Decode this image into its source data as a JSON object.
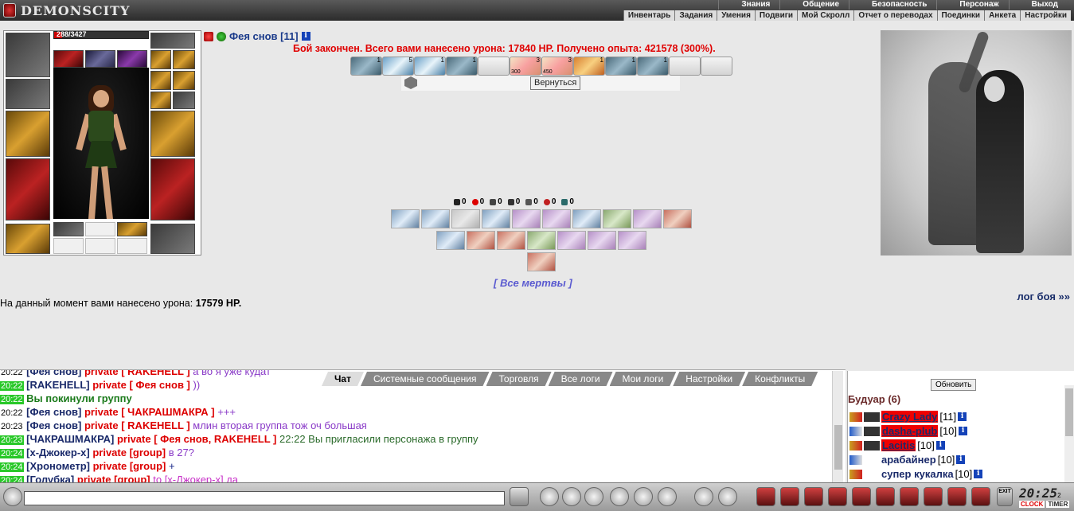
{
  "app": {
    "logo_text": "DEMONSCITY"
  },
  "main_menu": [
    "Знания",
    "Общение",
    "Безопасность",
    "Персонаж",
    "Выход"
  ],
  "sub_menu": [
    "Инвентарь",
    "Задания",
    "Умения",
    "Подвиги",
    "Мой Скролл",
    "Отчет о переводах",
    "Поединки",
    "Анкета",
    "Настройки"
  ],
  "character": {
    "hp_text": "288/3427",
    "hp_fraction": 0.084
  },
  "player": {
    "name": "Фея снов",
    "level": "[11]",
    "info": "i"
  },
  "battle": {
    "result": "Бой закончен. Всего вами нанесено урона: 17840 HP. Получено опыта: 421578 (300%).",
    "return_button": "Вернуться",
    "all_dead": "[ Все мертвы ]",
    "damage_now_label": "На данный момент вами нанесено урона:",
    "damage_now_value": "17579 HP.",
    "log_link": "лог боя »»"
  },
  "effects": [
    {
      "num": "1",
      "style": "c4"
    },
    {
      "num": "5",
      "style": "c1"
    },
    {
      "num": "1",
      "style": "c1"
    },
    {
      "num": "1",
      "style": "c4"
    },
    {
      "num": "",
      "style": "blank"
    },
    {
      "num": "3",
      "bottom": "300",
      "style": "c2"
    },
    {
      "num": "3",
      "bottom": "450",
      "style": "c2"
    },
    {
      "num": "1",
      "style": "c3"
    },
    {
      "num": "1",
      "style": "c4"
    },
    {
      "num": "1",
      "style": "c4"
    },
    {
      "num": "",
      "style": "blank"
    },
    {
      "num": "",
      "style": "blank"
    }
  ],
  "stats": [
    "0",
    "0",
    "0",
    "0",
    "0",
    "0",
    "0"
  ],
  "chat": {
    "tabs": [
      "Чат",
      "Системные сообщения",
      "Торговля",
      "Все логи",
      "Мои логи",
      "Настройки",
      "Конфликты"
    ],
    "lines": [
      {
        "time": "20:22",
        "tgreen": false,
        "nick": "[Фея снов]",
        "priv": "private [ RAKEHELL ]",
        "msg": "а во я уже кудат",
        "cls": "msg-purple"
      },
      {
        "time": "20:22",
        "tgreen": true,
        "nick": "[RAKEHELL]",
        "priv": "private [ Фея снов ]",
        "msg": "))",
        "cls": "msg-purple"
      },
      {
        "time": "20:22",
        "tgreen": true,
        "nick": "",
        "priv": "",
        "msg": "Вы покинули группу",
        "cls": "msg-green"
      },
      {
        "time": "20:22",
        "tgreen": false,
        "nick": "[Фея снов]",
        "priv": "private [ ЧАКРАШМАКРА ]",
        "msg": "+++",
        "cls": "msg-purple"
      },
      {
        "time": "20:23",
        "tgreen": false,
        "nick": "[Фея снов]",
        "priv": "private [ RAKEHELL ]",
        "msg": "млин вторая группа тож оч большая",
        "cls": "msg-purple"
      },
      {
        "time": "20:23",
        "tgreen": true,
        "nick": "[ЧАКРАШМАКРА]",
        "priv": "private [ Фея снов, RAKEHELL ]",
        "msg": "22:22 Вы пригласили персонажа в группу",
        "cls": "msg-dk"
      },
      {
        "time": "20:24",
        "tgreen": true,
        "nick": "[х-Джокер-х]",
        "priv": "private [group]",
        "msg": "в 27?",
        "cls": "msg-purple"
      },
      {
        "time": "20:24",
        "tgreen": true,
        "nick": "[Хронометр]",
        "priv": "private [group]",
        "msg": "+",
        "cls": "msg-blue"
      },
      {
        "time": "20:24",
        "tgreen": true,
        "nick": "[Голубка]",
        "priv": "private [group]",
        "msg": "to [х-Джокер-х] да",
        "cls": "msg-magenta"
      }
    ]
  },
  "userlist": {
    "refresh": "Обновить",
    "room": "Будуар (6)",
    "users": [
      {
        "name": "Crazy Lady",
        "level": "[11]",
        "hl": true
      },
      {
        "name": "dasha-plub",
        "level": "[10]",
        "hl": true
      },
      {
        "name": "Lacitis",
        "level": "[10]",
        "hl": true
      },
      {
        "name": "арабайнер",
        "level": "[10]",
        "hl": false
      },
      {
        "name": "супер кукалка",
        "level": "[10]",
        "hl": false
      }
    ]
  },
  "clock": {
    "time": "20:25",
    "suffix": "2",
    "label1": "CLOCK",
    "label2": "TIMER"
  },
  "exit_label": "EXIT"
}
